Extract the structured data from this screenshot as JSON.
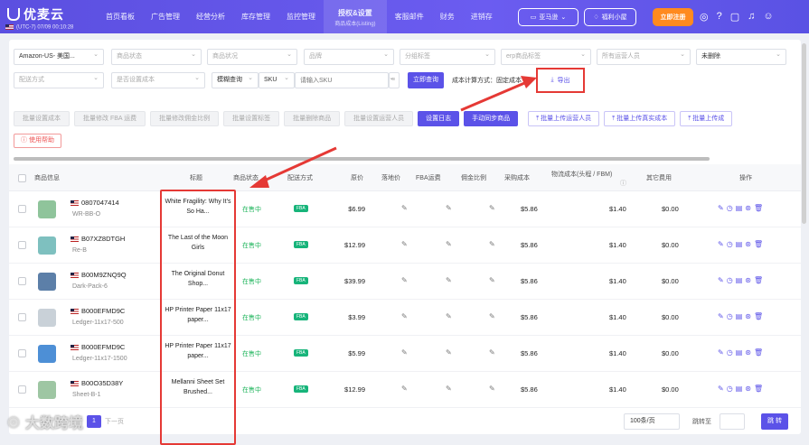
{
  "header": {
    "brand": "优麦云",
    "timezone": "(UTC-7) 07/09 00:10:28",
    "nav": [
      {
        "label": "首页看板"
      },
      {
        "label": "广告管理"
      },
      {
        "label": "经营分析"
      },
      {
        "label": "库存管理"
      },
      {
        "label": "监控管理"
      },
      {
        "label": "授权&设置",
        "sub": "商品成本(Listing)",
        "active": true
      },
      {
        "label": "客服邮件"
      },
      {
        "label": "财务"
      },
      {
        "label": "进销存"
      }
    ],
    "store_label": "亚马逊",
    "gift_label": "福利小屋",
    "register_label": "立即注册"
  },
  "filters": {
    "marketplace": "Amazon-US- 美国...",
    "product_status": "商品状态",
    "product_condition": "商品状况",
    "brand": "品牌",
    "category_tag": "分组标签",
    "erp_tag": "erp商品标签",
    "all_operators": "所有运营人员",
    "not_deleted": "未删除",
    "shipping_method": "配送方式",
    "cost_setting": "是否设置成本",
    "fuzzy_query": "模糊查询",
    "sku_label": "SKU",
    "sku_placeholder": "请输入SKU",
    "query_button": "立即查询",
    "cost_method": "成本计算方式：固定成本",
    "export_button": "导出"
  },
  "actions": {
    "gray": [
      "批量设置成本",
      "批量修改 FBA 运费",
      "批量修改佣金比例",
      "批量设置标签",
      "批量删除商品",
      "批量设置运营人员"
    ],
    "primary": [
      "设置日志",
      "手动同步商品"
    ],
    "outline": [
      "批量上传运营人员",
      "批量上传真实成本",
      "批量上传成"
    ],
    "help": "使用帮助"
  },
  "table": {
    "headers": {
      "product_info": "商品信息",
      "title": "标题",
      "status": "商品状态",
      "shipping": "配送方式",
      "price": "原价",
      "landed": "落地价",
      "fba_fee": "FBA运费",
      "commission": "佣金比例",
      "purchase_cost": "采购成本",
      "logistics": "物流成本(头程 / FBM)",
      "other": "其它费用",
      "ops": "操作"
    },
    "rows": [
      {
        "asin": "0807047414",
        "sku": "WR-BB-O",
        "title": "White Fragility: Why It's So Ha...",
        "status": "在售中",
        "ship": "FBA",
        "price": "$6.99",
        "cost": "$5.86",
        "logistics": "$1.40",
        "other": "$0.00"
      },
      {
        "asin": "B07XZ8DTGH",
        "sku": "Re-B",
        "title": "The Last of the Moon Girls",
        "status": "在售中",
        "ship": "FBA",
        "price": "$12.99",
        "cost": "$5.86",
        "logistics": "$1.40",
        "other": "$0.00"
      },
      {
        "asin": "B00M9ZNQ9Q",
        "sku": "Dark-Pack-6",
        "title": "The Original Donut Shop...",
        "status": "在售中",
        "ship": "FBA",
        "price": "$39.99",
        "cost": "$5.86",
        "logistics": "$1.40",
        "other": "$0.00"
      },
      {
        "asin": "B000EFMD9C",
        "sku": "Ledger-11x17-500",
        "title": "HP Printer Paper 11x17 paper...",
        "status": "在售中",
        "ship": "FBA",
        "price": "$3.99",
        "cost": "$5.86",
        "logistics": "$1.40",
        "other": "$0.00"
      },
      {
        "asin": "B000EFMD9C",
        "sku": "Ledger-11x17-1500",
        "title": "HP Printer Paper 11x17 paper...",
        "status": "在售中",
        "ship": "FBA",
        "price": "$5.99",
        "cost": "$5.86",
        "logistics": "$1.40",
        "other": "$0.00"
      },
      {
        "asin": "B00O35D38Y",
        "sku": "Sheet-B-1",
        "title": "Mellanni Sheet Set Brushed...",
        "status": "在售中",
        "ship": "FBA",
        "price": "$12.99",
        "cost": "$5.86",
        "logistics": "$1.40",
        "other": "$0.00"
      }
    ]
  },
  "footer": {
    "page": "1",
    "next": "下一页",
    "per_page": "100条/页",
    "jump_label": "跳转至",
    "jump_button": "跳 转"
  },
  "watermark": "大数跨境"
}
